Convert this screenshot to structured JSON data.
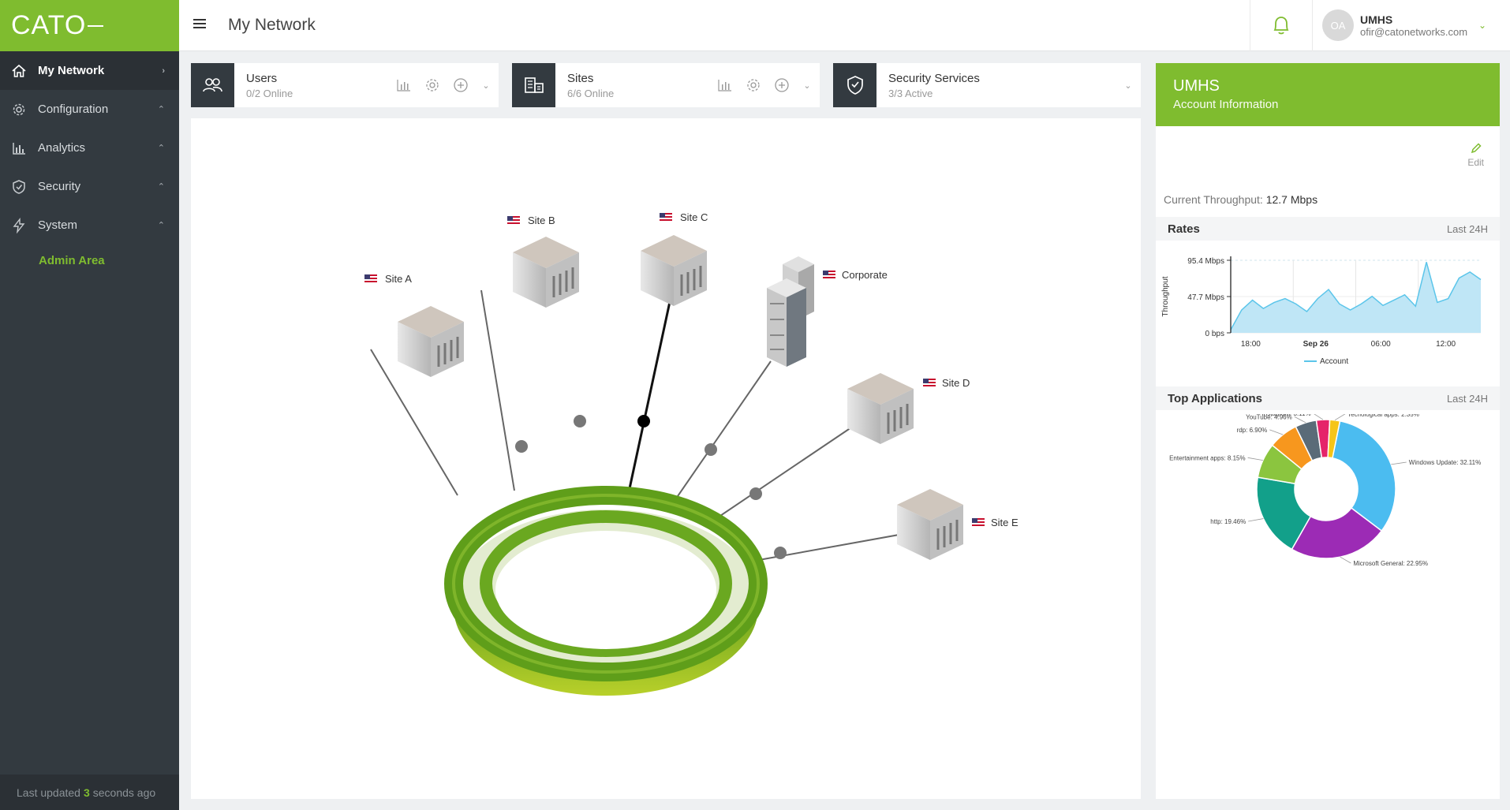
{
  "logo": "CATO",
  "sidebar": {
    "items": [
      {
        "label": "My Network",
        "caret": "›"
      },
      {
        "label": "Configuration",
        "caret": "⌃"
      },
      {
        "label": "Analytics",
        "caret": "⌃"
      },
      {
        "label": "Security",
        "caret": "⌃"
      },
      {
        "label": "System",
        "caret": "⌃"
      }
    ],
    "admin": "Admin Area",
    "last_updated": {
      "prefix": "Last updated",
      "value": "3",
      "suffix": "seconds ago"
    }
  },
  "header": {
    "title": "My Network",
    "user": {
      "initials": "OA",
      "name": "UMHS",
      "email": "ofir@catonetworks.com"
    }
  },
  "cards": {
    "users": {
      "title": "Users",
      "sub": "0/2 Online"
    },
    "sites": {
      "title": "Sites",
      "sub": "6/6 Online"
    },
    "security": {
      "title": "Security Services",
      "sub": "3/3 Active"
    }
  },
  "network": {
    "sites": [
      "Site A",
      "Site B",
      "Site C",
      "Corporate",
      "Site D",
      "Site E"
    ]
  },
  "panel": {
    "title": "UMHS",
    "subtitle": "Account Information",
    "edit": "Edit",
    "throughput_label": "Current Throughput:",
    "throughput_value": "12.7 Mbps",
    "rates_title": "Rates",
    "rates_range": "Last 24H",
    "apps_title": "Top Applications",
    "apps_range": "Last 24H"
  },
  "colors": {
    "brand": "#7fbc2f",
    "sidebar": "#333a40",
    "line": "#5bc5ea"
  },
  "chart_data": [
    {
      "type": "area",
      "title": "Rates",
      "ylabel": "Throughput",
      "y_ticks": [
        "95.4 Mbps",
        "47.7 Mbps",
        "0 bps"
      ],
      "ylim": [
        0,
        95.4
      ],
      "x_ticks": [
        "18:00",
        "Sep 26",
        "06:00",
        "12:00"
      ],
      "legend": "Account",
      "series": [
        {
          "name": "Account",
          "values": [
            4,
            30,
            43,
            32,
            40,
            45,
            38,
            28,
            45,
            57,
            38,
            30,
            38,
            48,
            36,
            43,
            50,
            35,
            93,
            40,
            45,
            72,
            80,
            70
          ]
        }
      ]
    },
    {
      "type": "pie",
      "title": "Top Applications",
      "slices": [
        {
          "label": "Windows Update",
          "value": 32.11,
          "display": "Windows Update: 32.11%",
          "color": "#4bbcf0"
        },
        {
          "label": "Microsoft General",
          "value": 22.95,
          "display": "Microsoft General: 22.95%",
          "color": "#9c2bb5"
        },
        {
          "label": "http",
          "value": 19.46,
          "display": "http: 19.46%",
          "color": "#12a08a"
        },
        {
          "label": "Entertainment apps",
          "value": 8.15,
          "display": "Entertainment apps: 8.15%",
          "color": "#8bc53f"
        },
        {
          "label": "rdp",
          "value": 6.9,
          "display": "rdp: 6.90%",
          "color": "#f7971e"
        },
        {
          "label": "YouTube",
          "value": 4.96,
          "display": "YouTube: 4.96%",
          "color": "#5a6b78"
        },
        {
          "label": "Instagram",
          "value": 3.11,
          "display": "Instagram: 3.11%",
          "color": "#e5246a"
        },
        {
          "label": "Techological apps",
          "value": 2.35,
          "display": "Techological apps: 2.35%",
          "color": "#f5c518"
        }
      ]
    }
  ]
}
